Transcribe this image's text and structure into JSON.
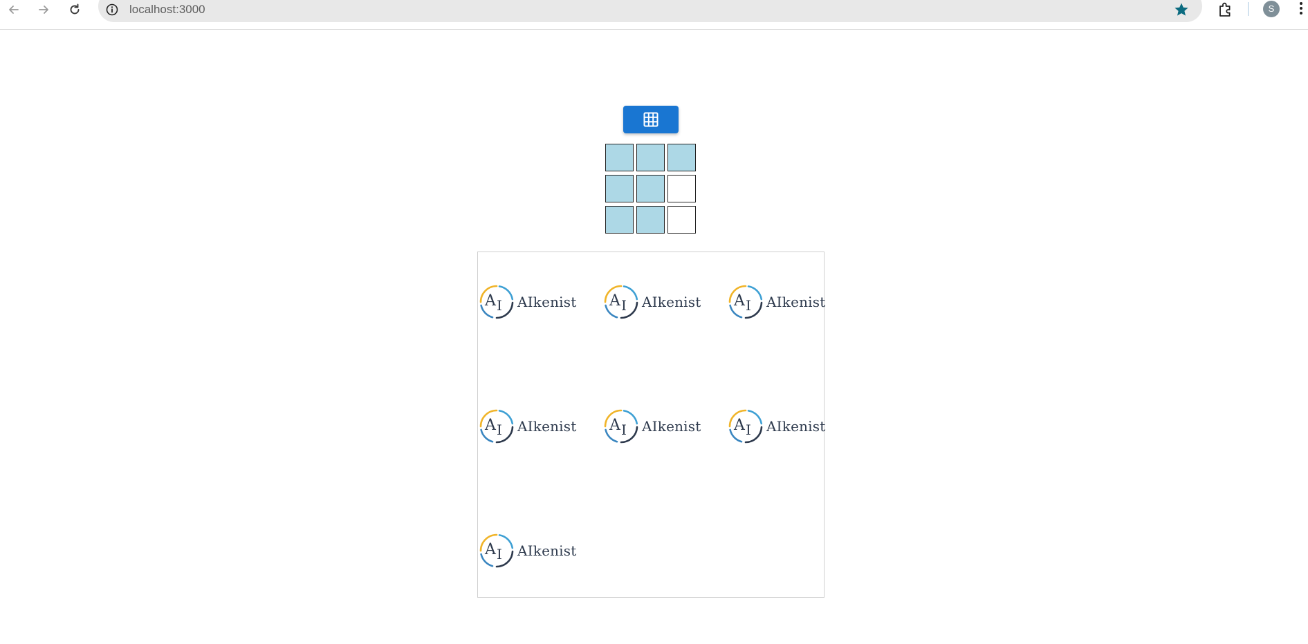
{
  "browser": {
    "url": "localhost:3000",
    "profile_initial": "S"
  },
  "colors": {
    "button_blue": "#1976d2",
    "selected_cell": "#add8e6",
    "star": "#0b6b80"
  },
  "layout_button": {
    "icon": "grid-icon"
  },
  "grid": {
    "rows": 3,
    "cols": 3,
    "selected": [
      [
        true,
        true,
        true
      ],
      [
        true,
        true,
        false
      ],
      [
        true,
        true,
        false
      ]
    ]
  },
  "logos": [
    {
      "text": "AIkenist"
    },
    {
      "text": "AIkenist"
    },
    {
      "text": "AIkenist"
    },
    {
      "text": "AIkenist"
    },
    {
      "text": "AIkenist"
    },
    {
      "text": "AIkenist"
    },
    {
      "text": "AIkenist"
    }
  ]
}
